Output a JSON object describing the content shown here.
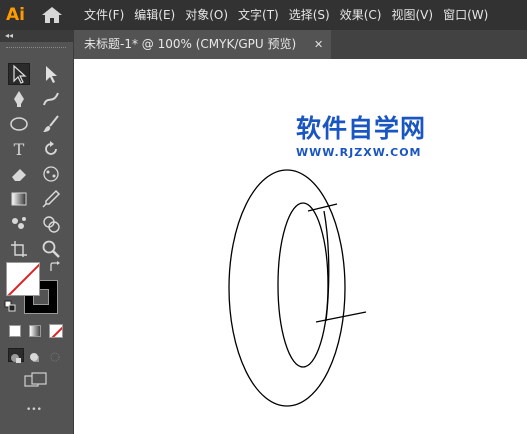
{
  "app": {
    "logo_text": "Ai",
    "menus": [
      "文件(F)",
      "编辑(E)",
      "对象(O)",
      "文字(T)",
      "选择(S)",
      "效果(C)",
      "视图(V)",
      "窗口(W)"
    ]
  },
  "toolbar": {
    "collapse_glyph": "◂◂",
    "type_tool_glyph": "T",
    "more_glyph": "•••",
    "fill_color": "#ffffff",
    "stroke_color": "#000000"
  },
  "document": {
    "tab_title": "未标题-1* @ 100% (CMYK/GPU 预览)",
    "tab_close": "✕"
  },
  "canvas": {
    "watermark_title": "软件自学网",
    "watermark_url": "WWW.RJZXW.COM"
  },
  "colors": {
    "menubar_bg": "#323232",
    "panel_bg": "#535353",
    "logo_orange": "#ff9a00",
    "watermark_blue": "#1a56c2"
  }
}
